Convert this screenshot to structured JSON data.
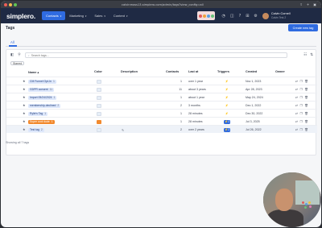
{
  "browser": {
    "url": "calvinmoss13.simplero.com/admin/tags?view_config=all"
  },
  "app": {
    "logo": "simplero.",
    "nav": [
      {
        "label": "Contacts",
        "active": true
      },
      {
        "label": "Marketing",
        "active": false
      },
      {
        "label": "Sales",
        "active": false
      },
      {
        "label": "Content",
        "active": false
      }
    ],
    "user": {
      "name": "Calvin Cornell",
      "subtitle": "Calvin Test 2"
    }
  },
  "page": {
    "title": "Tags",
    "create_button": "Create new tag",
    "tab": "All",
    "search_placeholder": "Search tags...",
    "filter_chip": "Starred",
    "footer": "Showing all 7 tags"
  },
  "table": {
    "headers": {
      "name": "Name",
      "color": "Color",
      "description": "Description",
      "contacts": "Contacts",
      "last_at": "Last at",
      "triggers": "Triggers",
      "created": "Created",
      "owner": "Owner"
    },
    "rows": [
      {
        "name": "CM Funnel Opt-In",
        "count": "1",
        "tag_color": "#dde7fb",
        "swatch": "#e6eef7",
        "contacts": "1",
        "last_at": "over 1 year",
        "trigger": "⚡",
        "trigger_style": "plain",
        "created": "Nov 1, 2023",
        "highlight": false
      },
      {
        "name": "GDPR consent",
        "count": "11",
        "tag_color": "#dde7fb",
        "swatch": "#e6eef7",
        "contacts": "11",
        "last_at": "about 3 years",
        "trigger": "⚡",
        "trigger_style": "plain",
        "created": "Apr 28, 2023",
        "highlight": false
      },
      {
        "name": "Import 05/24/2024",
        "count": "1",
        "tag_color": "#dde7fb",
        "swatch": "#e6eef7",
        "contacts": "1",
        "last_at": "about 1 year",
        "trigger": "⚡",
        "trigger_style": "plain",
        "created": "May 24, 2024",
        "highlight": false
      },
      {
        "name": "membership-declined",
        "count": "2",
        "tag_color": "#dde7fb",
        "swatch": "#e6eef7",
        "contacts": "2",
        "last_at": "3 months",
        "trigger": "⚡",
        "trigger_style": "plain",
        "created": "Dec 1, 2022",
        "highlight": false
      },
      {
        "name": "Rylie's Tag",
        "count": "1",
        "tag_color": "#dde7fb",
        "swatch": "#e6eef7",
        "contacts": "1",
        "last_at": "28 minutes",
        "trigger": "⚡",
        "trigger_style": "plain",
        "created": "Dec 30, 2022",
        "highlight": false
      },
      {
        "name": "Super cool dude",
        "count": "1",
        "tag_color": "#f28a2e",
        "swatch": "#f28a2e",
        "contacts": "1",
        "last_at": "28 minutes",
        "trigger": "⚡1",
        "trigger_style": "blue",
        "created": "Jul 3, 2025",
        "highlight": false
      },
      {
        "name": "Test tag",
        "count": "2",
        "tag_color": "#dde7fb",
        "swatch": "#e6eef7",
        "contacts": "2",
        "last_at": "over 2 years",
        "trigger": "⚡1",
        "trigger_style": "blue",
        "created": "Jul 26, 2022",
        "highlight": true
      }
    ]
  },
  "colors": {
    "primary": "#2f6be0",
    "nav_bg": "#1f2a44",
    "orange_tag": "#f28a2e"
  }
}
